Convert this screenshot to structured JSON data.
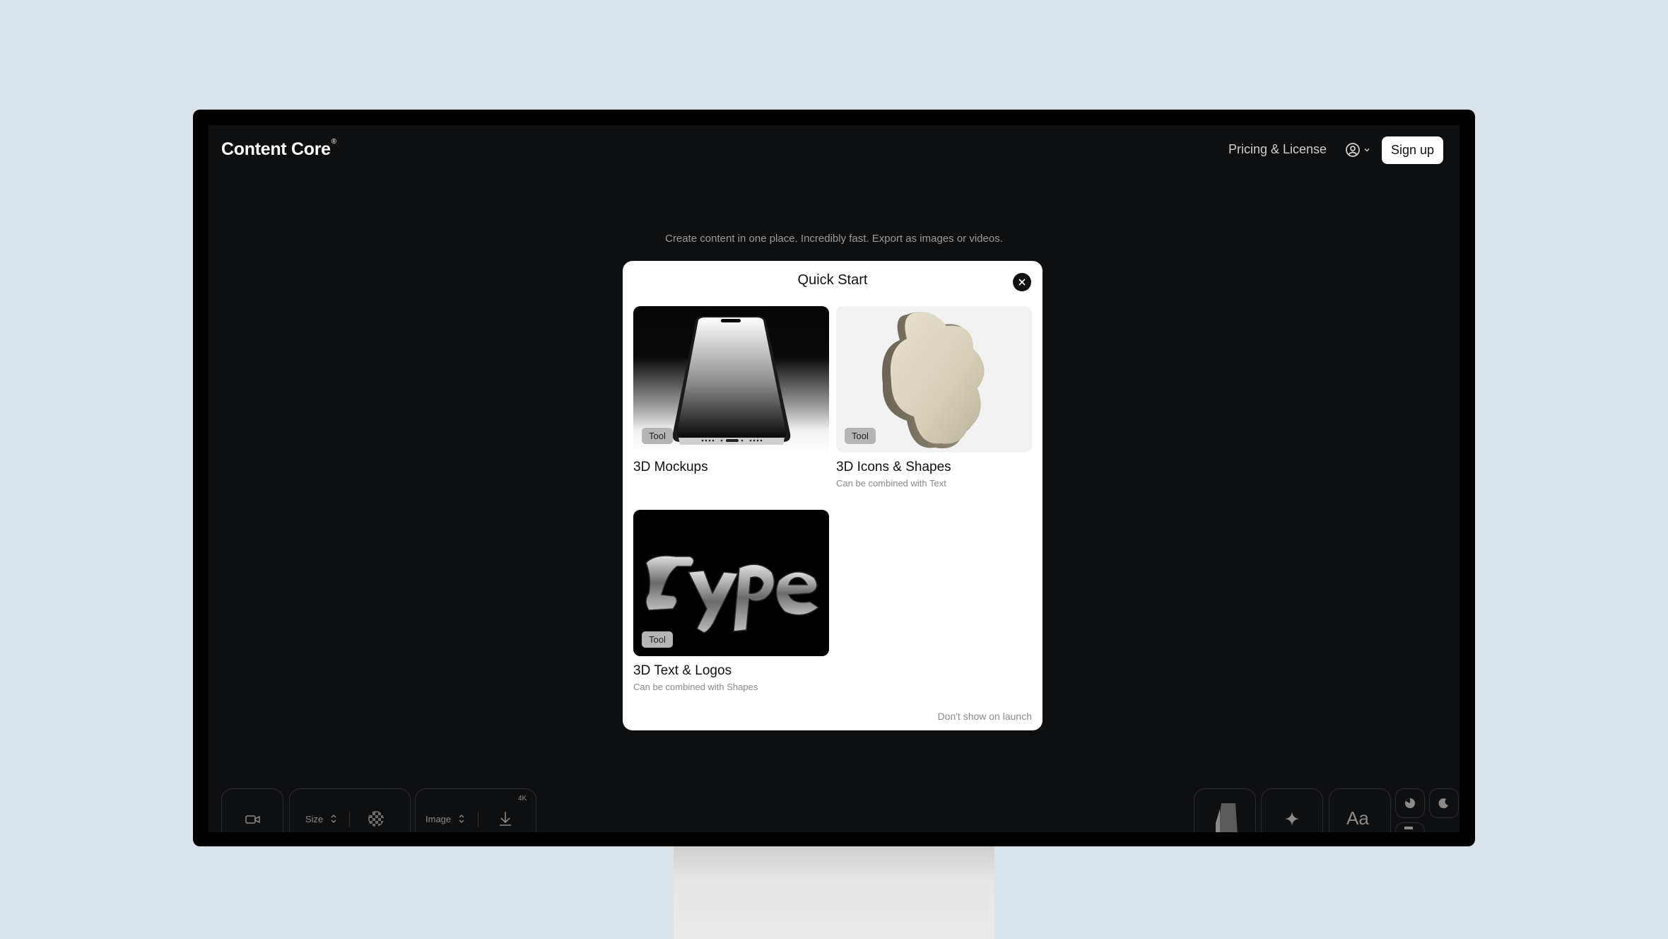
{
  "app": {
    "brand": "Content Core",
    "brand_mark": "®",
    "nav": {
      "pricing_label": "Pricing & License",
      "signup_label": "Sign up"
    },
    "tagline": "Create content in one place. Incredibly fast. Export as images or videos."
  },
  "toolbar": {
    "size_label": "Size",
    "image_label": "Image",
    "resolution_badge": "4K",
    "text_tool_label": "Aa"
  },
  "modal": {
    "title": "Quick Start",
    "cards": [
      {
        "title": "3D Mockups",
        "subtitle": "",
        "badge": "Tool"
      },
      {
        "title": "3D Icons & Shapes",
        "subtitle": "Can be combined with Text",
        "badge": "Tool"
      },
      {
        "title": "3D Text & Logos",
        "subtitle": "Can be combined with Shapes",
        "badge": "Tool"
      }
    ],
    "dont_show_label": "Don't show on launch"
  },
  "colors": {
    "page_bg": "#dbe3ea",
    "screen_bg": "#0e0f11",
    "modal_bg": "#ffffff",
    "badge_bg": "#b5b5b5"
  }
}
